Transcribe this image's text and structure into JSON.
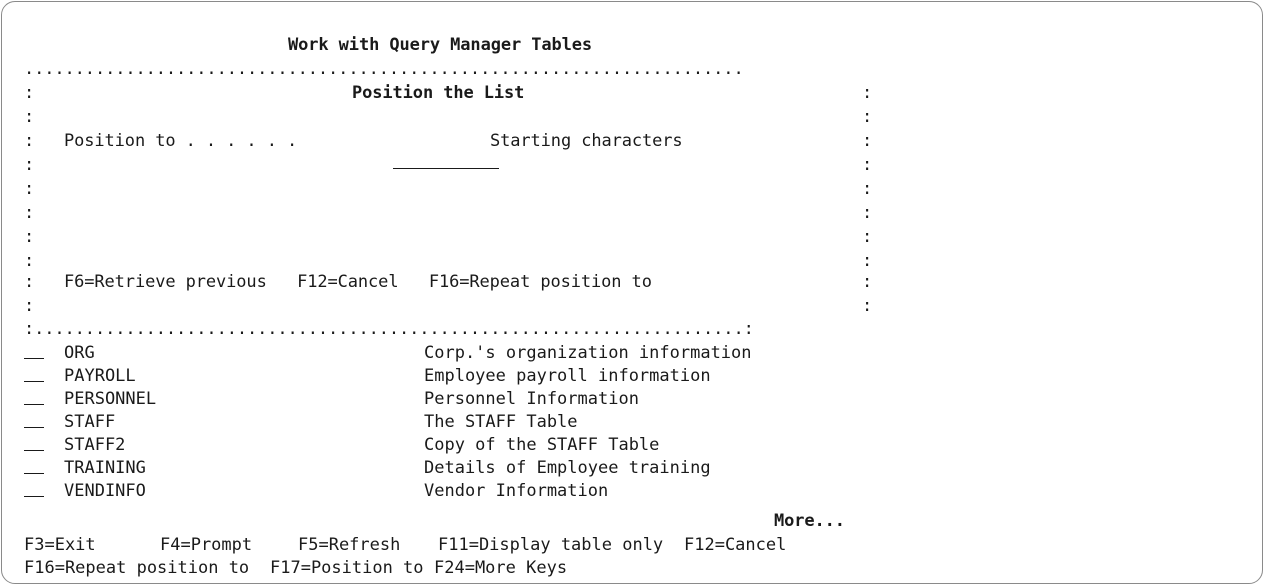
{
  "screen_title": "Work with Query Manager Tables",
  "window": {
    "border_top": ".......................................................................",
    "title": "Position the List",
    "position_label": "Position to . . . . . .",
    "position_value": "",
    "position_hint": "Starting characters",
    "fkeys": "F6=Retrieve previous   F12=Cancel   F16=Repeat position to",
    "border_bottom": ":......................................................................:"
  },
  "table_rows": [
    {
      "name": "ORG",
      "description": "Corp.'s organization information"
    },
    {
      "name": "PAYROLL",
      "description": "Employee payroll information"
    },
    {
      "name": "PERSONNEL",
      "description": "Personnel Information"
    },
    {
      "name": "STAFF",
      "description": "The STAFF Table"
    },
    {
      "name": "STAFF2",
      "description": "Copy of the STAFF Table"
    },
    {
      "name": "TRAINING",
      "description": "Details of Employee training"
    },
    {
      "name": "VENDINFO",
      "description": "Vendor Information"
    }
  ],
  "more_indicator": "More...",
  "function_keys_row1": [
    "F3=Exit",
    "F4=Prompt",
    "F5=Refresh",
    "F11=Display table only",
    "F12=Cancel"
  ],
  "function_keys_row2": [
    "F16=Repeat position to",
    "F17=Position to",
    "F24=More Keys"
  ]
}
